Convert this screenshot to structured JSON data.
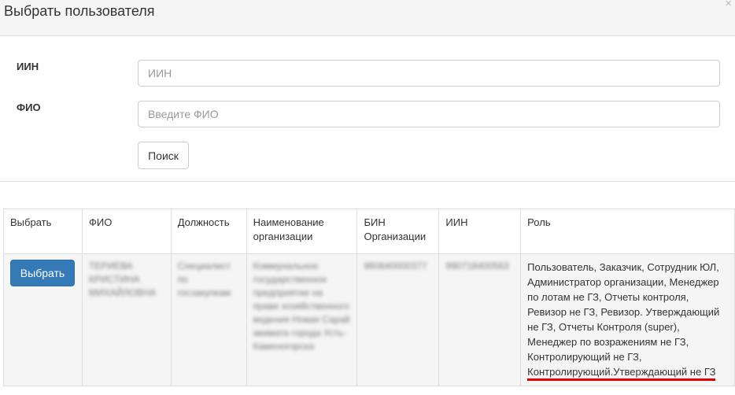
{
  "modal": {
    "title": "Выбрать пользователя",
    "close_icon": "×"
  },
  "form": {
    "iin_label": "ИИН",
    "iin_placeholder": "ИИН",
    "iin_value": "",
    "fio_label": "ФИО",
    "fio_placeholder": "Введите ФИО",
    "fio_value": "",
    "search_label": "Поиск"
  },
  "table": {
    "columns": [
      "Выбрать",
      "ФИО",
      "Должность",
      "Наименование организации",
      "БИН Организации",
      "ИИН",
      "Роль"
    ],
    "rows": [
      {
        "select_label": "Выбрать",
        "fio": "ТЕРИЕВА КРИСТИНА МИХАЙЛОВНА",
        "position": "Специалист по госзакупкам",
        "organization": "Коммунальное государственное предприятие на праве хозяйственного ведения Новая Сарай акимата города Усть-Каменогорска",
        "bin": "960640000377",
        "iin": "990718400563",
        "role_text": "Пользователь, Заказчик, Сотрудник ЮЛ, Администратор организации, Менеджер по лотам не ГЗ, Отчеты контроля, Ревизор не ГЗ, Ревизор. Утверждающий не ГЗ, Отчеты Контроля (super), Менеджер по возражениям не ГЗ, Контролирующий не ГЗ,",
        "role_highlight": "Контролирующий.Утверждающий не ГЗ"
      }
    ]
  },
  "colors": {
    "primary": "#337ab7",
    "highlight_underline": "#e00000"
  }
}
